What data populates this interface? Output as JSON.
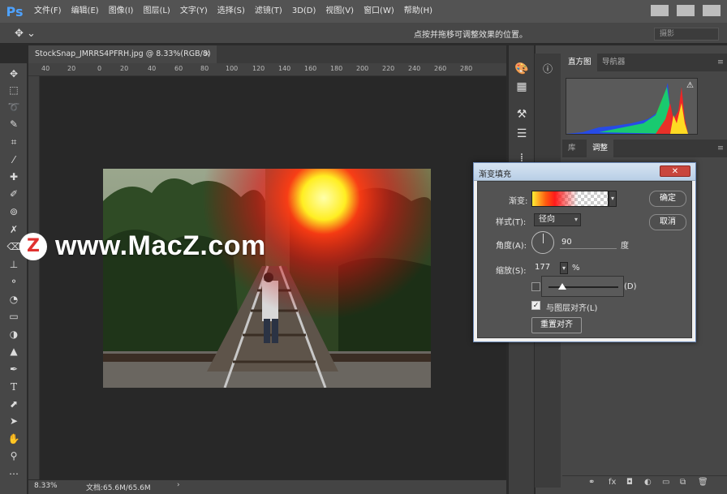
{
  "app": {
    "logo": "Ps"
  },
  "menu": [
    "文件(F)",
    "编辑(E)",
    "图像(I)",
    "图层(L)",
    "文字(Y)",
    "选择(S)",
    "滤镜(T)",
    "3D(D)",
    "视图(V)",
    "窗口(W)",
    "帮助(H)"
  ],
  "options_bar": {
    "hint": "点按并拖移可调整效果的位置。",
    "workspace": "摄影"
  },
  "document": {
    "tab_title": "StockSnap_JMRRS4PFRH.jpg @ 8.33%(RGB/8)",
    "close_glyph": "×"
  },
  "ruler_h": [
    "40",
    "20",
    "0",
    "20",
    "40",
    "60",
    "80",
    "100",
    "120",
    "140",
    "160",
    "180",
    "200",
    "220",
    "240",
    "260",
    "280"
  ],
  "status": {
    "zoom": "8.33%",
    "doc_size": "文档:65.6M/65.6M",
    "arrow": "›"
  },
  "watermark": {
    "logo": "Z",
    "text": "www.MacZ.com"
  },
  "panels": {
    "tab_histogram": "直方图",
    "tab_navigator": "导航器",
    "tab_library": "库",
    "tab_adjustments": "调整"
  },
  "dialog": {
    "title": "渐变填充",
    "close_glyph": "✕",
    "gradient_label": "渐变:",
    "style_label": "样式(T):",
    "style_value": "径向",
    "angle_label": "角度(A):",
    "angle_value": "90",
    "angle_unit": "度",
    "scale_label": "缩放(S):",
    "scale_value": "177",
    "scale_unit": "%",
    "reverse_suffix": "(D)",
    "align_label": "与图层对齐(L)",
    "reset_button": "重置对齐",
    "ok_button": "确定",
    "cancel_button": "取消",
    "scale_slider_fraction": 0.2
  },
  "colors": {
    "accent_blue": "#4ea2ff",
    "close_red": "#c9463d"
  }
}
